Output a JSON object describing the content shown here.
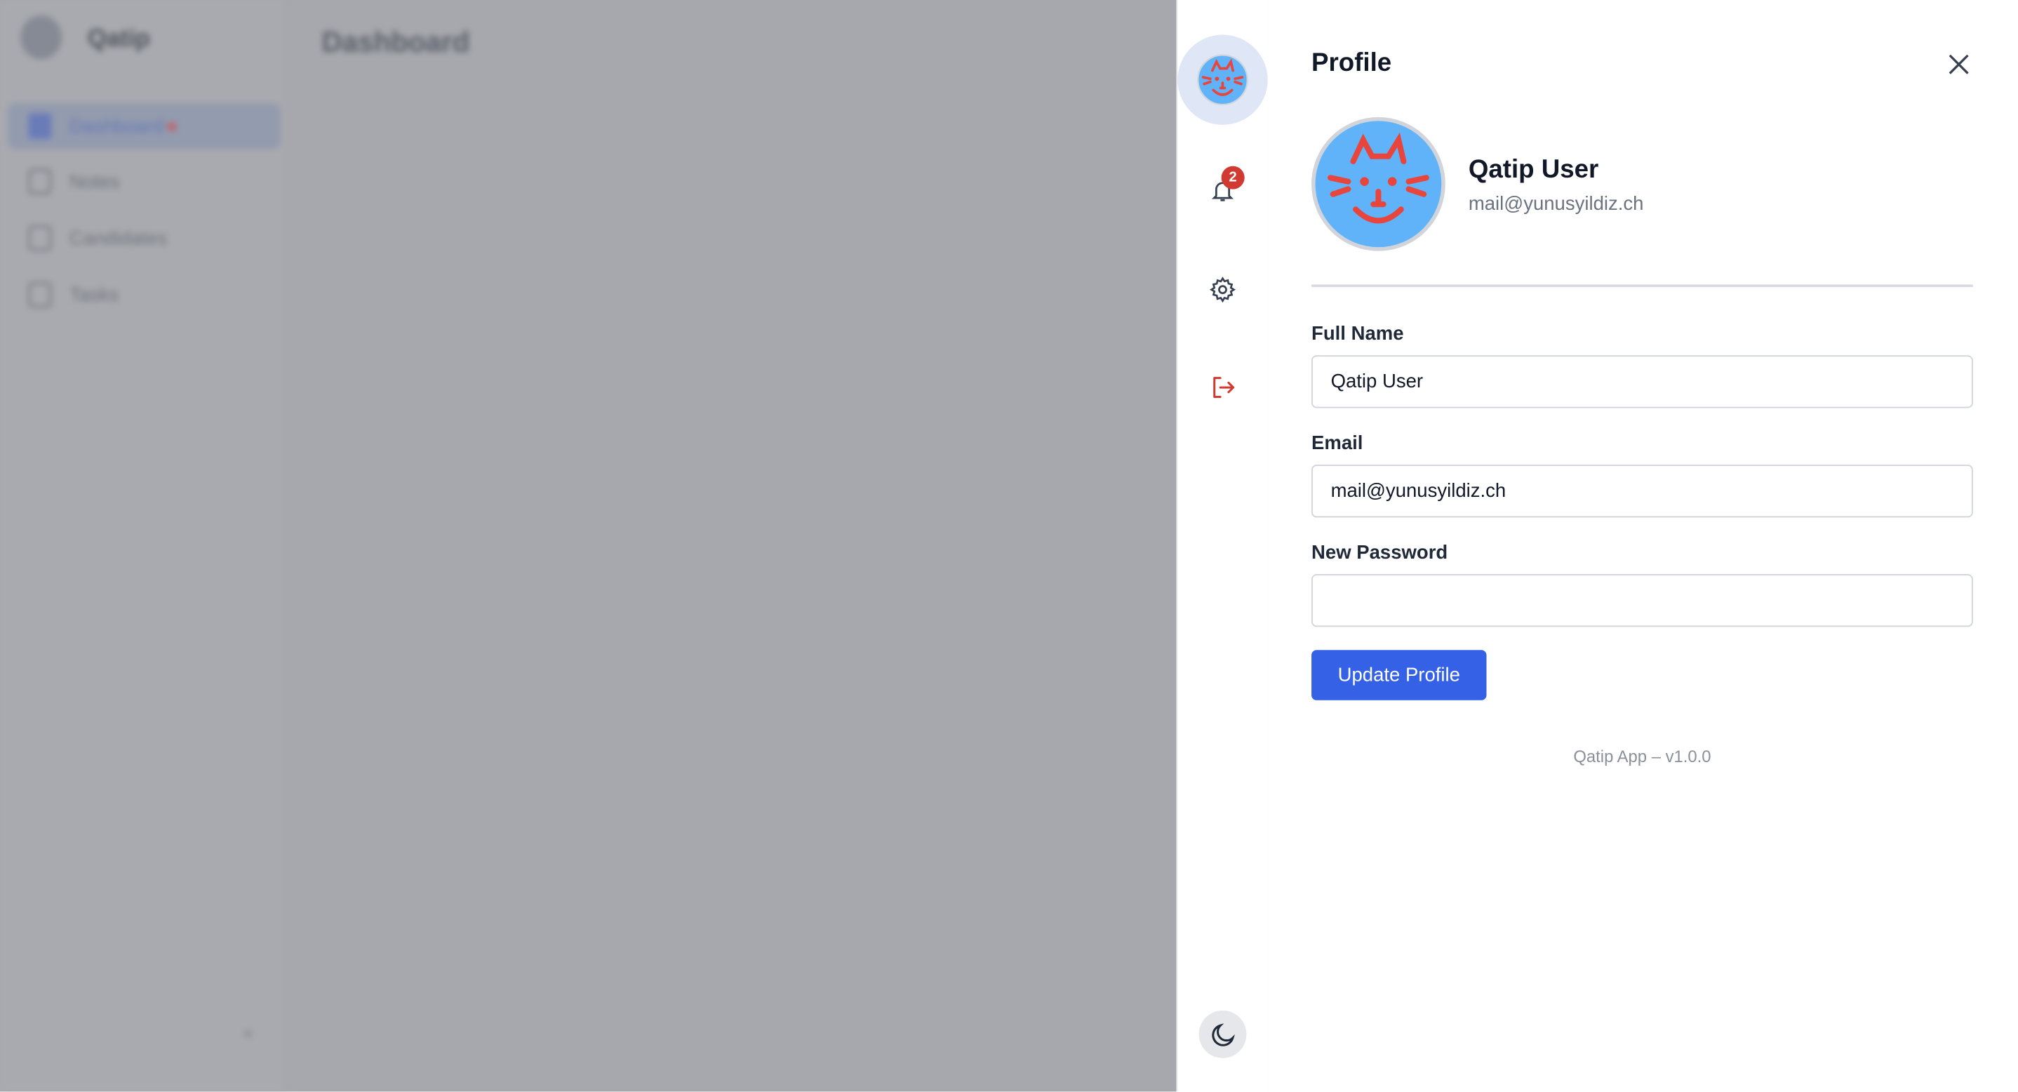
{
  "app": {
    "brand": "Qatip",
    "page_title": "Dashboard",
    "nav": [
      {
        "label": "Dashboard",
        "active": true
      },
      {
        "label": "Notes"
      },
      {
        "label": "Candidates"
      },
      {
        "label": "Tasks"
      }
    ],
    "collapse_glyph": "«"
  },
  "rail": {
    "notification_count": "2"
  },
  "profile": {
    "title": "Profile",
    "user_name": "Qatip User",
    "user_email": "mail@yunusyildiz.ch",
    "fields": {
      "full_name": {
        "label": "Full Name",
        "value": "Qatip User"
      },
      "email": {
        "label": "Email",
        "value": "mail@yunusyildiz.ch"
      },
      "password": {
        "label": "New Password",
        "value": ""
      }
    },
    "submit_label": "Update Profile",
    "footer": "Qatip App – v1.0.0"
  },
  "colors": {
    "accent": "#3461e5",
    "avatar_bg": "#60b3f8",
    "cat": "#e8453c",
    "danger": "#d13a30"
  }
}
